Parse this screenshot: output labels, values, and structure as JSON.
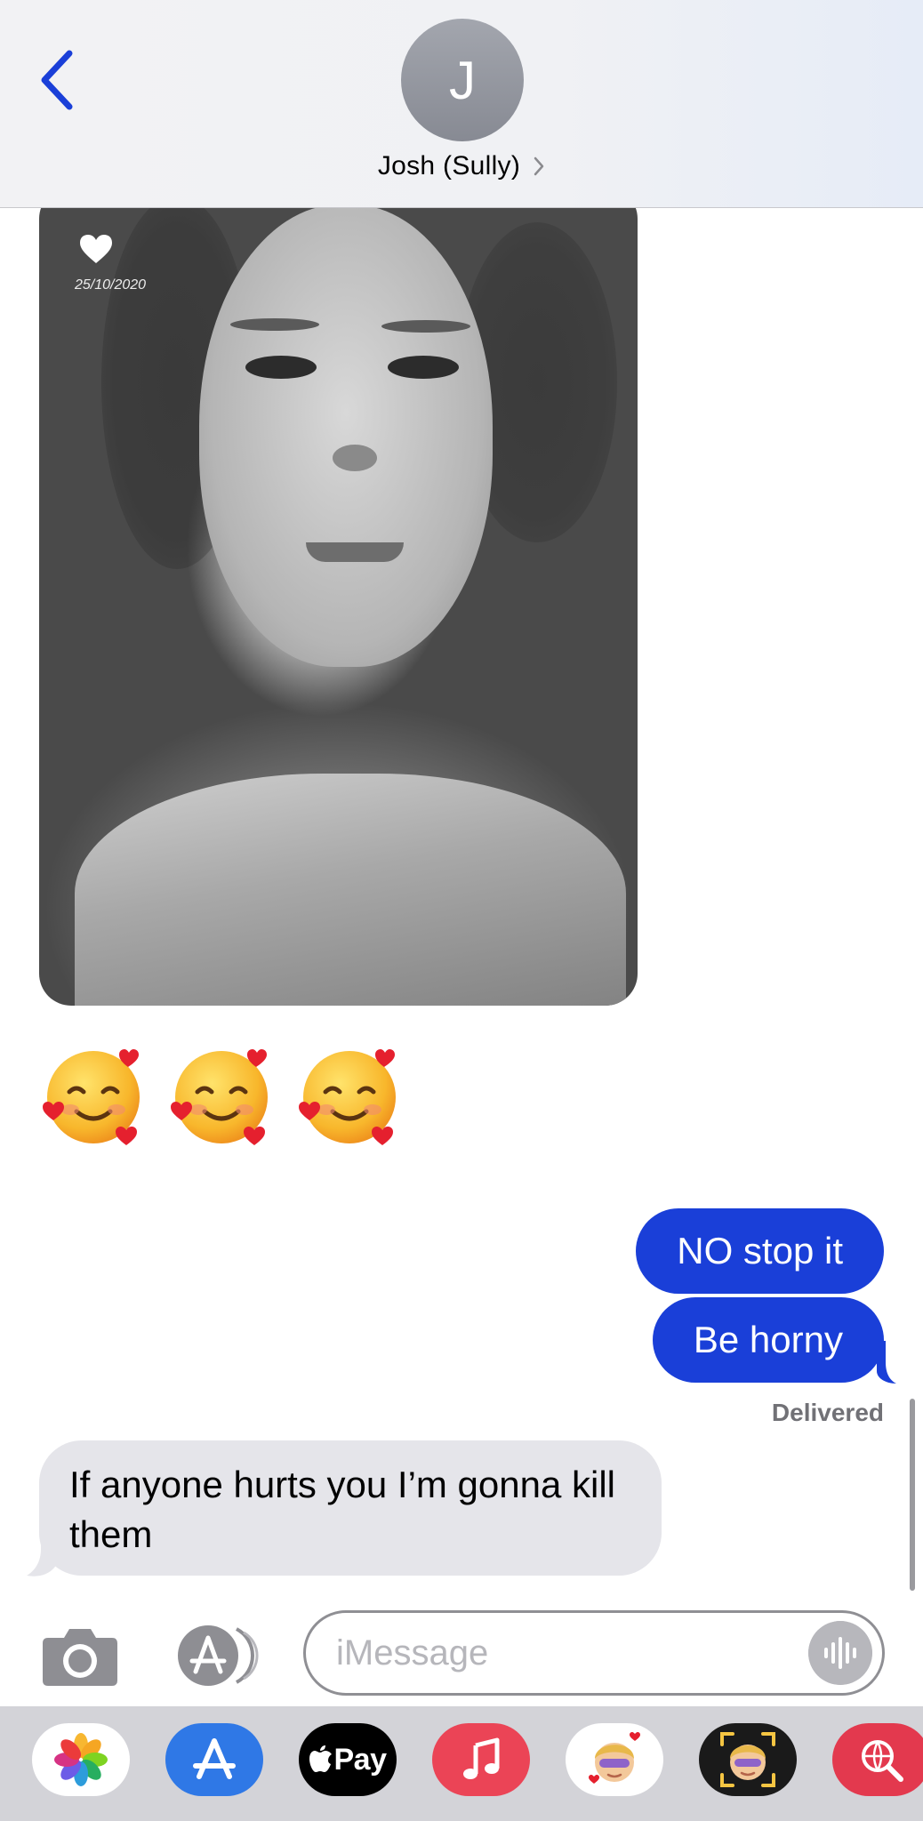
{
  "header": {
    "avatar_initial": "J",
    "contact_name": "Josh (Sully)"
  },
  "conversation": {
    "photo": {
      "date_stamp": "25/10/2020"
    },
    "emoji_message": [
      "🥰",
      "🥰",
      "🥰"
    ],
    "outgoing_messages": [
      "NO stop it",
      "Be horny"
    ],
    "status": "Delivered",
    "incoming_message": "If anyone hurts you I’m gonna kill them"
  },
  "input_bar": {
    "placeholder": "iMessage"
  },
  "app_drawer": {
    "apple_pay_label": "Pay",
    "apps": [
      "photos-app-icon",
      "app-store-icon",
      "apple-pay-icon",
      "music-icon",
      "memoji-stickers-icon",
      "memoji-icon",
      "image-search-icon"
    ]
  },
  "colors": {
    "accent_blue": "#1a3fd8",
    "incoming_bubble": "#e5e5ea",
    "header_bg": "#f2f2f4",
    "drawer_bg": "#d3d3d8"
  }
}
